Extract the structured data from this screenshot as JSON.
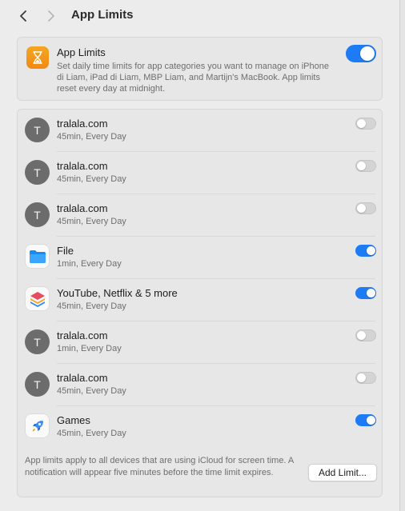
{
  "header": {
    "title": "App Limits"
  },
  "summary": {
    "title": "App Limits",
    "description": "Set daily time limits for app categories you want to manage on iPhone di Liam, iPad di Liam, MBP Liam, and Martijn's MacBook. App limits reset every day at midnight.",
    "enabled": true,
    "icon": "hourglass-icon"
  },
  "limits": [
    {
      "name": "tralala.com",
      "detail": "45min, Every Day",
      "avatar": "T",
      "enabled": false
    },
    {
      "name": "tralala.com",
      "detail": "45min, Every Day",
      "avatar": "T",
      "enabled": false
    },
    {
      "name": "tralala.com",
      "detail": "45min, Every Day",
      "avatar": "T",
      "enabled": false
    },
    {
      "name": "File",
      "detail": "1min, Every Day",
      "icon": "folder-icon",
      "enabled": true
    },
    {
      "name": "YouTube, Netflix & 5 more",
      "detail": "45min, Every Day",
      "icon": "stack-icon",
      "enabled": true
    },
    {
      "name": "tralala.com",
      "detail": "1min, Every Day",
      "avatar": "T",
      "enabled": false
    },
    {
      "name": "tralala.com",
      "detail": "45min, Every Day",
      "avatar": "T",
      "enabled": false
    },
    {
      "name": "Games",
      "detail": "45min, Every Day",
      "icon": "rocket-icon",
      "enabled": true
    }
  ],
  "footer": {
    "note": "App limits apply to all devices that are using iCloud for screen time. A notification will appear five minutes before the time limit expires.",
    "add_button": "Add Limit..."
  },
  "colors": {
    "accent": "#1e7bf6",
    "hourglass": "#f5a623"
  }
}
